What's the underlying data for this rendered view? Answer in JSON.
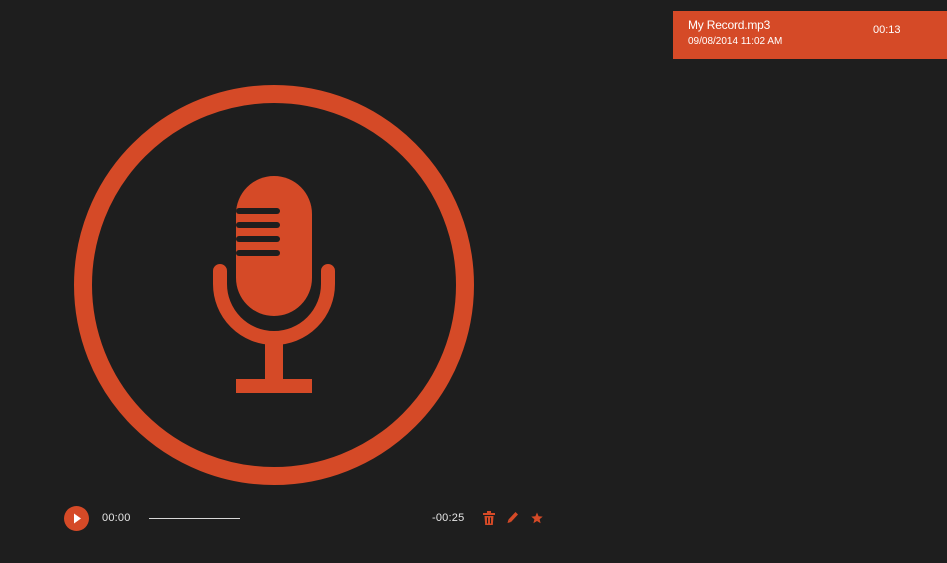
{
  "recording": {
    "name": "My Record.mp3",
    "date": "09/08/2014 11:02 AM",
    "duration": "00:13"
  },
  "player": {
    "current_time": "00:00",
    "remaining_time": "-00:25",
    "progress": 0
  },
  "icons": {
    "mic": "microphone-icon",
    "play": "play-icon",
    "delete": "trash-icon",
    "edit": "pencil-icon",
    "favorite": "star-icon"
  },
  "colors": {
    "accent": "#d54a27",
    "background": "#1e1e1e",
    "text": "#e6e6e6"
  }
}
